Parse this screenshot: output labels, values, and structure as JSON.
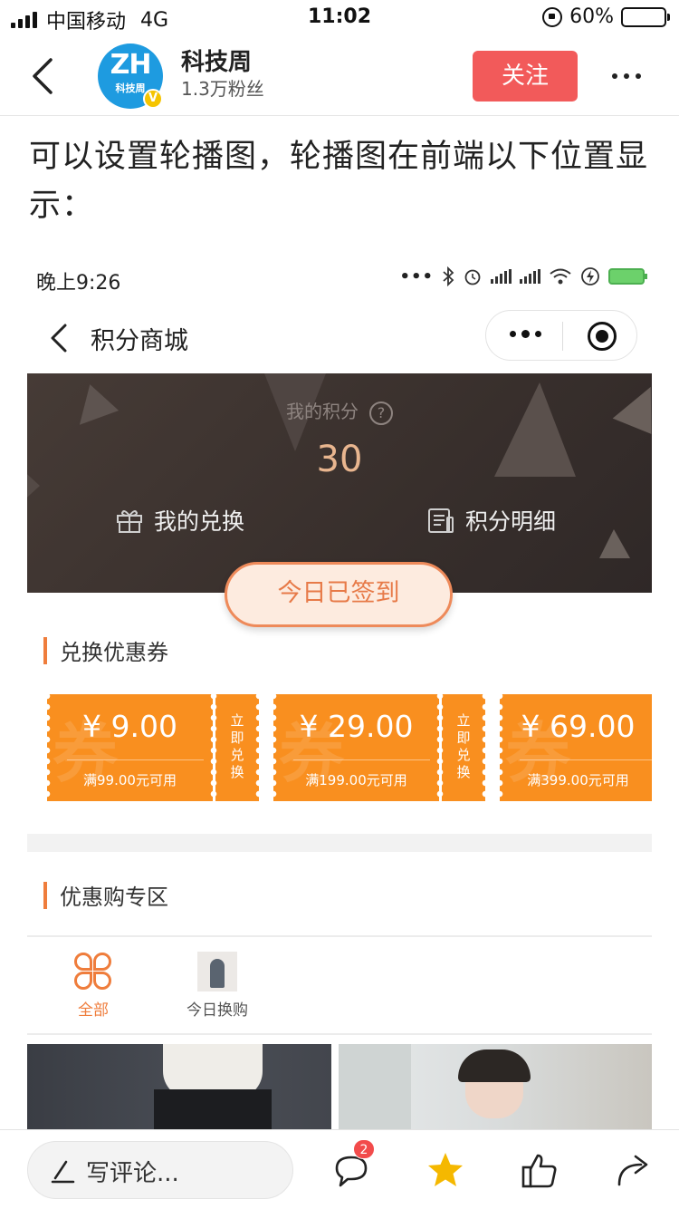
{
  "status_bar": {
    "carrier": "中国移动",
    "network": "4G",
    "time": "11:02",
    "battery": "60%"
  },
  "header": {
    "account_name": "科技周",
    "fans": "1.3万粉丝",
    "avatar_text": "ZH",
    "avatar_sub": "科技周",
    "verified_mark": "V",
    "follow_label": "关注"
  },
  "article": {
    "paragraph": "可以设置轮播图，轮播图在前端以下位置显示："
  },
  "screenshot": {
    "status_time": "晚上9:26",
    "nav_title": "积分商城",
    "points_label": "我的积分",
    "help_mark": "?",
    "points_value": "30",
    "my_exchange": "我的兑换",
    "points_detail": "积分明细",
    "signed_button": "今日已签到",
    "coupon_section": "兑换优惠券",
    "coupons": [
      {
        "amount": "¥ 9.00",
        "condition": "满99.00元可用",
        "action": "立即兑换"
      },
      {
        "amount": "¥ 29.00",
        "condition": "满199.00元可用",
        "action": "立即兑换"
      },
      {
        "amount": "¥ 69.00",
        "condition": "满399.00元可用",
        "action": ""
      }
    ],
    "coupon_watermark": "券",
    "promo_section": "优惠购专区",
    "tabs": [
      {
        "label": "全部"
      },
      {
        "label": "今日换购"
      }
    ]
  },
  "bottom_bar": {
    "comment_placeholder": "写评论...",
    "comment_count": "2"
  },
  "colors": {
    "accent": "#ef7d3c",
    "coupon": "#f98f1f",
    "follow": "#f25a5a",
    "banner": "#3d3431",
    "star": "#f5b800"
  }
}
